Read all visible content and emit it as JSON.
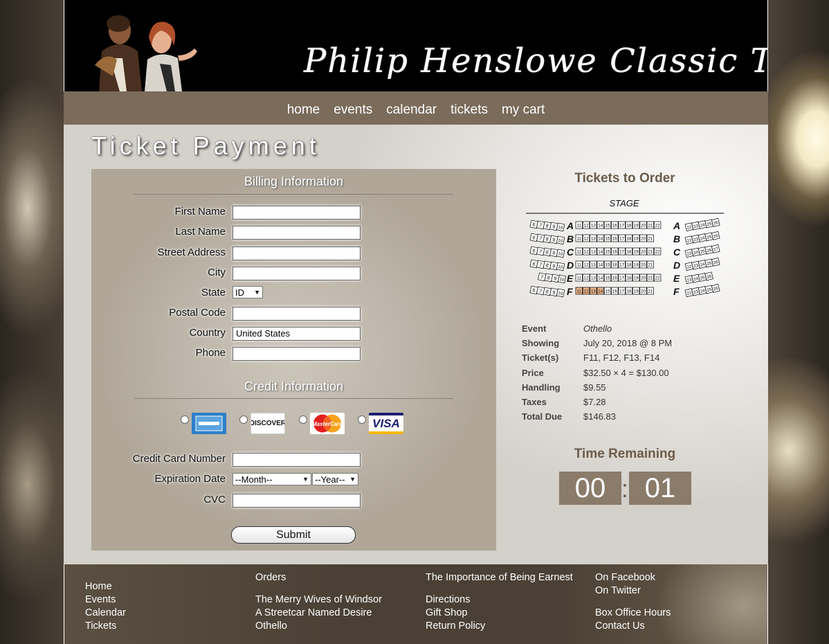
{
  "banner": {
    "title": "Philip Henslowe Classic Theatre"
  },
  "nav": {
    "items": [
      "home",
      "events",
      "calendar",
      "tickets",
      "my cart"
    ]
  },
  "page_title": "Ticket Payment",
  "billing": {
    "section_title": "Billing Information",
    "fields": {
      "first_name": {
        "label": "First Name",
        "value": ""
      },
      "last_name": {
        "label": "Last Name",
        "value": ""
      },
      "street": {
        "label": "Street Address",
        "value": ""
      },
      "city": {
        "label": "City",
        "value": ""
      },
      "state": {
        "label": "State",
        "value": "ID"
      },
      "postal": {
        "label": "Postal Code",
        "value": ""
      },
      "country": {
        "label": "Country",
        "value": "United States"
      },
      "phone": {
        "label": "Phone",
        "value": ""
      }
    }
  },
  "credit": {
    "section_title": "Credit Information",
    "cards": [
      {
        "name": "American Express",
        "icon": "amex-logo-icon"
      },
      {
        "name": "DISCOVER",
        "icon": "discover-logo-icon"
      },
      {
        "name": "MasterCard",
        "icon": "mastercard-logo-icon"
      },
      {
        "name": "VISA",
        "icon": "visa-logo-icon"
      }
    ],
    "card_number_label": "Credit Card Number",
    "card_number_value": "",
    "expiration_label": "Expiration Date",
    "month_selected": "--Month--",
    "year_selected": "--Year--",
    "cvc_label": "CVC",
    "cvc_value": "",
    "submit_label": "Submit"
  },
  "order": {
    "title": "Tickets to Order",
    "stage_label": "STAGE",
    "rows": [
      {
        "key": "Event",
        "value": "Othello"
      },
      {
        "key": "Showing",
        "value": "July 20, 2018 @ 8 PM"
      },
      {
        "key": "Ticket(s)",
        "value": "F11, F12, F13, F14"
      },
      {
        "key": "Price",
        "value": "$32.50 × 4 = $130.00"
      },
      {
        "key": "Handling",
        "value": "$9.55"
      },
      {
        "key": "Taxes",
        "value": "$7.28"
      },
      {
        "key": "Total Due",
        "value": "$146.83"
      }
    ]
  },
  "seat_map": {
    "rows": [
      "A",
      "B",
      "C",
      "D",
      "E",
      "F"
    ],
    "center_seats": [
      [
        "11",
        "12",
        "13",
        "14",
        "15",
        "16",
        "17",
        "18",
        "19",
        "20",
        "21",
        "22"
      ],
      [
        "11",
        "12",
        "13",
        "14",
        "15",
        "16",
        "17",
        "18",
        "19",
        "20",
        "21"
      ],
      [
        "11",
        "12",
        "13",
        "14",
        "15",
        "16",
        "17",
        "18",
        "19",
        "20",
        "21",
        "22"
      ],
      [
        "11",
        "12",
        "13",
        "14",
        "15",
        "16",
        "17",
        "18",
        "19",
        "20",
        "21"
      ],
      [
        "11",
        "12",
        "13",
        "14",
        "15",
        "16",
        "17",
        "18",
        "19",
        "20",
        "21",
        "22"
      ],
      [
        "11",
        "12",
        "13",
        "14",
        "15",
        "16",
        "17",
        "18",
        "19",
        "20",
        "21"
      ]
    ],
    "left_seats": [
      [
        "6",
        "7",
        "8",
        "9",
        "10"
      ],
      [
        "6",
        "7",
        "8",
        "9",
        "10"
      ],
      [
        "6",
        "7",
        "8",
        "9",
        "10"
      ],
      [
        "6",
        "7",
        "8",
        "9",
        "10"
      ],
      [
        "7",
        "8",
        "9",
        "10"
      ],
      [
        "6",
        "7",
        "8",
        "9",
        "10"
      ]
    ],
    "right_seats": [
      [
        "22",
        "23",
        "24",
        "25",
        "26"
      ],
      [
        "22",
        "23",
        "24",
        "25",
        "26"
      ],
      [
        "23",
        "24",
        "25",
        "26",
        "27"
      ],
      [
        "22",
        "23",
        "24",
        "25",
        "26"
      ],
      [
        "23",
        "24",
        "25",
        "26"
      ],
      [
        "22",
        "23",
        "24",
        "25",
        "26"
      ]
    ],
    "selected": [
      "F11",
      "F12",
      "F13",
      "F14"
    ],
    "colors": {
      "selected": "#e8b48c",
      "seat": "#ffffff",
      "stroke": "#000000"
    }
  },
  "timer": {
    "title": "Time Remaining",
    "minutes": "00",
    "separator": ":",
    "seconds": "01"
  },
  "footer": {
    "col1": [
      "Home",
      "Events",
      "Calendar",
      "Tickets"
    ],
    "col2": [
      "Orders",
      "The Merry Wives of Windsor",
      "A Streetcar Named Desire",
      "Othello"
    ],
    "col3": [
      "The Importance of Being Earnest",
      "Directions",
      "Gift Shop",
      "Return Policy"
    ],
    "col4": [
      "On Facebook",
      "On Twitter",
      "Box Office Hours",
      "Contact Us"
    ]
  },
  "colors": {
    "nav_bg": "#7a6b5a",
    "accent_text": "#6b5b4a",
    "timer_bg": "#8a7b6a",
    "panel_bg": "#bdb5a9"
  }
}
